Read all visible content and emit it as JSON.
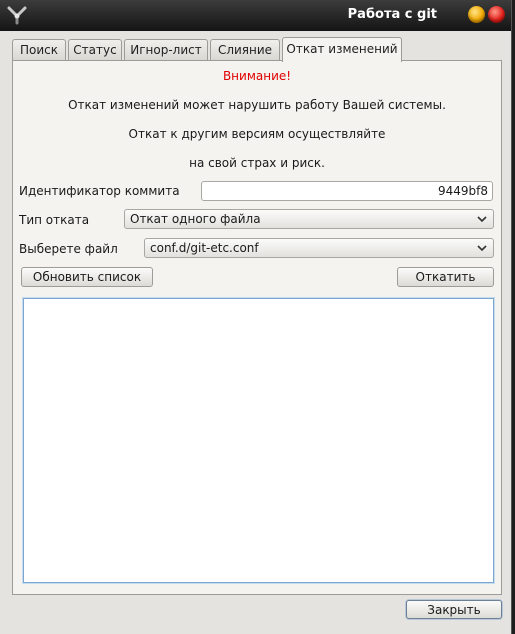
{
  "window": {
    "title": "Работа с git"
  },
  "tabs": [
    {
      "label": "Поиск"
    },
    {
      "label": "Статус"
    },
    {
      "label": "Игнор-лист"
    },
    {
      "label": "Слияние"
    },
    {
      "label": "Откат изменений",
      "active": true
    }
  ],
  "warning": {
    "title": "Внимание!",
    "line1": "Откат изменений может нарушить работу Вашей системы.",
    "line2": "Откат к другим версиям осуществляйте",
    "line3": "на свой страх и риск."
  },
  "form": {
    "commit_label": "Идентификатор коммита",
    "commit_value": "9449bf8",
    "rollback_type_label": "Тип отката",
    "rollback_type_value": "Откат одного файла",
    "file_label": "Выберете файл",
    "file_value": "conf.d/git-etc.conf"
  },
  "buttons": {
    "refresh": "Обновить список",
    "rollback": "Откатить",
    "close": "Закрыть"
  },
  "colors": {
    "warning": "#e00000",
    "titlebar": "#1e1e1e",
    "panel": "#f4f3f0"
  },
  "icons": {
    "app": "git-tool-icon",
    "minimize": "minimize-icon",
    "close": "close-icon",
    "dropdown": "chevron-down-icon"
  }
}
